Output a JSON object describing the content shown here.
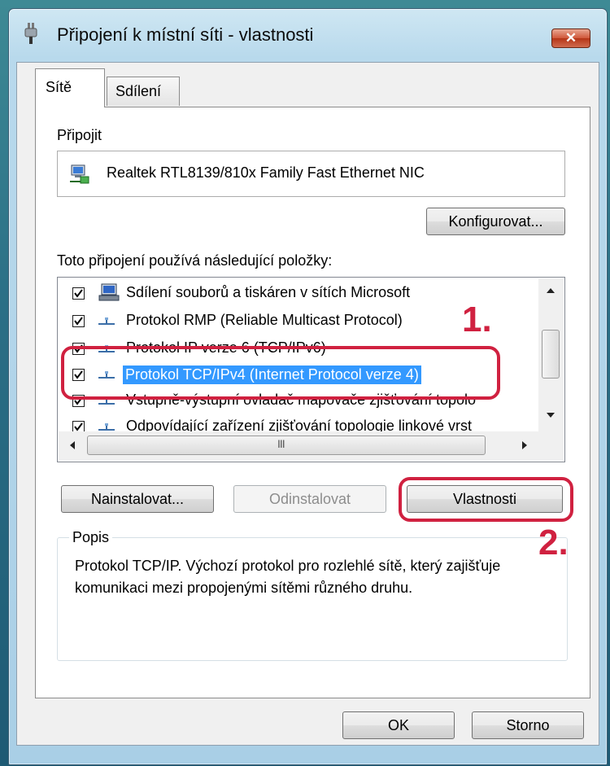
{
  "window": {
    "title": "Připojení k místní síti - vlastnosti",
    "close_symbol": "✕"
  },
  "tabs": [
    {
      "label": "Sítě",
      "active": true
    },
    {
      "label": "Sdílení",
      "active": false
    }
  ],
  "connect": {
    "label": "Připojit",
    "adapter": "Realtek RTL8139/810x Family Fast Ethernet NIC",
    "configure_button": "Konfigurovat..."
  },
  "items_label": "Toto připojení používá následující položky:",
  "items": [
    {
      "label": "Sdílení souborů a tiskáren v sítích Microsoft",
      "checked": true,
      "icon": "computer-network-icon"
    },
    {
      "label": "Protokol RMP (Reliable Multicast Protocol)",
      "checked": true,
      "icon": "protocol-icon"
    },
    {
      "label": "Protokol IP verze 6 (TCP/IPv6)",
      "checked": true,
      "icon": "protocol-icon"
    },
    {
      "label": "Protokol TCP/IPv4 (Internet Protocol verze 4)",
      "checked": true,
      "icon": "protocol-icon",
      "selected": true
    },
    {
      "label": "Vstupně-výstupní ovladač mapovače zjišťování topolo",
      "checked": true,
      "icon": "protocol-icon"
    },
    {
      "label": "Odpovídající zařízení zjišťování topologie linkové vrst",
      "checked": true,
      "icon": "protocol-icon"
    }
  ],
  "scrollbar": {
    "h_grip": "III"
  },
  "buttons": {
    "install": "Nainstalovat...",
    "uninstall": "Odinstalovat",
    "properties": "Vlastnosti",
    "ok": "OK",
    "cancel": "Storno"
  },
  "description": {
    "legend": "Popis",
    "text": "Protokol TCP/IP. Výchozí protokol pro rozlehlé sítě, který zajišťuje komunikaci mezi propojenými sítěmi různého druhu."
  },
  "annotations": {
    "step1": "1.",
    "step2": "2.",
    "color": "#d02140"
  },
  "colors": {
    "selection": "#3399ff",
    "close_button": "#c8452a"
  }
}
